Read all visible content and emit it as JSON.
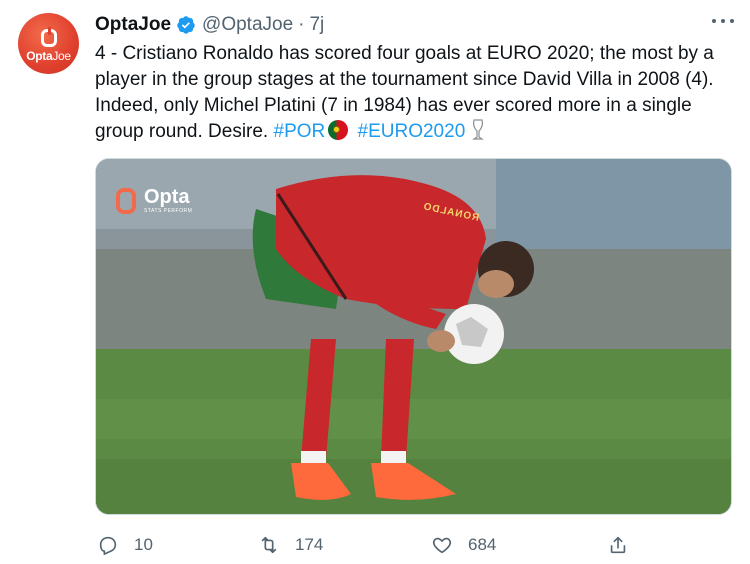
{
  "account": {
    "name": "OptaJoe",
    "handle": "@OptaJoe",
    "separator": "·",
    "time": "7j",
    "avatar_text_bold": "Opta",
    "avatar_text_light": "Joe"
  },
  "tweet": {
    "text_1": "4 - Cristiano Ronaldo has scored four goals at EURO 2020; the most by a player in the group stages at the tournament since David Villa in 2008 (4). Indeed, only Michel Platini (7 in 1984) has ever scored more in a single group round. Desire. ",
    "hashtag_1": "#POR",
    "hashtag_2": "#EURO2020"
  },
  "media": {
    "watermark_brand": "Opta",
    "watermark_sub": "STATS PERFORM",
    "shirt_name": "RONALDO"
  },
  "actions": {
    "reply_count": "10",
    "retweet_count": "174",
    "like_count": "684"
  },
  "icons": [
    "verified-badge-icon",
    "more-icon",
    "portugal-flag-icon",
    "trophy-icon",
    "reply-icon",
    "retweet-icon",
    "like-icon",
    "share-icon"
  ],
  "colors": {
    "accent": "#1d9bf0",
    "secondary_text": "#536471",
    "avatar_red": "#e0402e"
  }
}
